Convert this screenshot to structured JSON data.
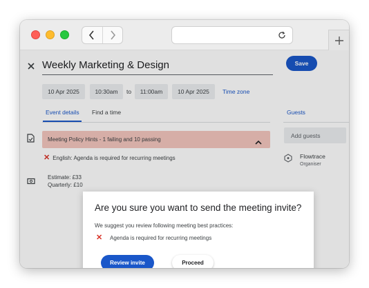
{
  "event": {
    "title": "Weekly Marketing & Design",
    "save_label": "Save",
    "start_date": "10 Apr 2025",
    "start_time": "10:30am",
    "to_label": "to",
    "end_time": "11:00am",
    "end_date": "10 Apr 2025",
    "time_zone_label": "Time zone"
  },
  "tabs": [
    {
      "label": "Event details",
      "active": true
    },
    {
      "label": "Find a time",
      "active": false
    }
  ],
  "hints": {
    "banner_text": "Meeting Policy Hints - 1 failing and 10 passing",
    "failing_item": "English: Agenda is required for recurring meetings"
  },
  "estimate": {
    "line1": "Estimate: £33",
    "line2": "Quarterly: £10"
  },
  "guests": {
    "heading": "Guests",
    "add_placeholder": "Add guests",
    "list": [
      {
        "name": "Flowtrace",
        "role": "Organiser"
      }
    ]
  },
  "dialog": {
    "title": "Are you sure you want to send the meeting invite?",
    "subtitle": "We suggest you review following meeting best practices:",
    "items": [
      "Agenda is required for recurring meetings"
    ],
    "review_label": "Review invite",
    "proceed_label": "Proceed"
  },
  "colors": {
    "accent": "#1a57c9",
    "hint_banner": "#f4c7bf",
    "fail": "#d93025"
  }
}
